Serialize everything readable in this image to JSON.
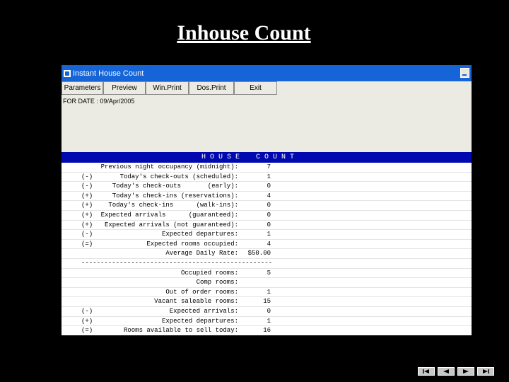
{
  "slide_title": "Inhouse Count",
  "window": {
    "title": "Instant House Count",
    "toolbar": [
      "Parameters",
      "Preview",
      "Win.Print",
      "Dos.Print",
      "Exit"
    ],
    "for_date": "FOR DATE : 09/Apr/2005",
    "header_left": "H O U S E",
    "header_right": "C O U N T",
    "rows": [
      {
        "sign": "",
        "label": "Previous night occupancy (midnight):",
        "value": "7"
      },
      {
        "sign": "(-)",
        "label": "Today's check-outs (scheduled):",
        "value": "1"
      },
      {
        "sign": "(-)",
        "label": "Today's check-outs       (early):",
        "value": "0"
      },
      {
        "sign": "(+)",
        "label": "Today's check-ins (reservations):",
        "value": "4"
      },
      {
        "sign": "(+)",
        "label": "Today's check-ins      (walk-ins):",
        "value": "0"
      },
      {
        "sign": "(+)",
        "label": "Expected arrivals      (guaranteed):",
        "value": "0"
      },
      {
        "sign": "(+)",
        "label": "Expected arrivals (not guaranteed):",
        "value": "0"
      },
      {
        "sign": "(-)",
        "label": "Expected departures:",
        "value": "1"
      },
      {
        "sign": "(=)",
        "label": "Expected rooms occupied:",
        "value": "4"
      },
      {
        "sign": "",
        "label": "Average Daily Rate:",
        "value": "$50.00"
      },
      {
        "sign": "",
        "label": "dash",
        "value": ""
      },
      {
        "sign": "",
        "label": "Occupied rooms:",
        "value": "5"
      },
      {
        "sign": "",
        "label": "Comp rooms:",
        "value": ""
      },
      {
        "sign": "",
        "label": "Out of order rooms:",
        "value": "1"
      },
      {
        "sign": "",
        "label": "Vacant saleable rooms:",
        "value": "15"
      },
      {
        "sign": "(-)",
        "label": "Expected arrivals:",
        "value": "0"
      },
      {
        "sign": "(+)",
        "label": "Expected departures:",
        "value": "1"
      },
      {
        "sign": "(=)",
        "label": "Rooms available to sell today:",
        "value": "16"
      }
    ],
    "dash_line": "--------------------------------------------------",
    "double_line": "=================================================="
  },
  "nav": [
    "first-slide-icon",
    "previous-slide-icon",
    "next-slide-icon",
    "last-slide-icon"
  ]
}
